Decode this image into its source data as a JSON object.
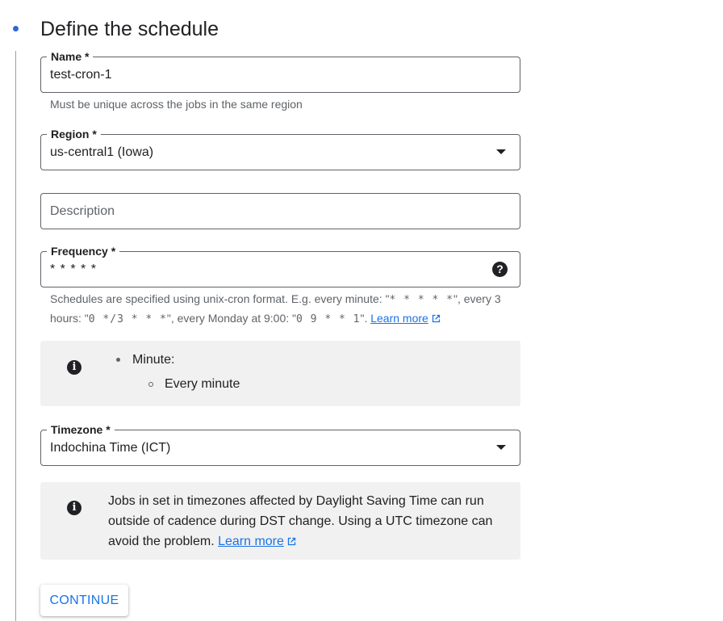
{
  "colors": {
    "accent": "#3367d6",
    "link": "#1a73e8",
    "info_bg": "#f1f1f1",
    "border": "#5f6368"
  },
  "step": {
    "title": "Define the schedule"
  },
  "fields": {
    "name": {
      "label": "Name *",
      "value": "test-cron-1",
      "hint": "Must be unique across the jobs in the same region"
    },
    "region": {
      "label": "Region *",
      "value": "us-central1 (Iowa)"
    },
    "description": {
      "placeholder": "Description",
      "value": ""
    },
    "frequency": {
      "label": "Frequency *",
      "value": "* * * * *",
      "help_icon": "help-circle-icon",
      "hint": {
        "part1": "Schedules are specified using unix-cron format. E.g. every minute: \"",
        "code1": "* * * * *",
        "part2": "\", every 3 hours: \"",
        "code2": "0 */3 * * *",
        "part3": "\", every Monday at 9:00: \"",
        "code3": "0 9 * * 1",
        "part4": "\". ",
        "link": "Learn more"
      }
    },
    "timezone": {
      "label": "Timezone *",
      "value": "Indochina Time (ICT)"
    }
  },
  "frequency_summary": {
    "icon": "info-icon",
    "item": "Minute:",
    "subitem": "Every minute"
  },
  "dst_notice": {
    "icon": "info-icon",
    "text": "Jobs in set in timezones affected by Daylight Saving Time can run outside of cadence during DST change. Using a UTC timezone can avoid the problem. ",
    "link": "Learn more"
  },
  "actions": {
    "continue_label": "CONTINUE"
  }
}
